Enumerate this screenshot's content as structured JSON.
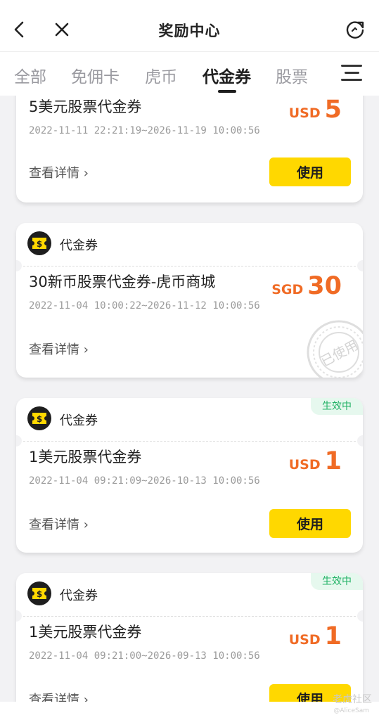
{
  "header": {
    "title": "奖励中心",
    "back_icon": "back-arrow-icon",
    "close_icon": "close-icon",
    "refresh_icon": "refresh-icon"
  },
  "tabs": [
    {
      "label": "全部",
      "active": false
    },
    {
      "label": "免佣卡",
      "active": false
    },
    {
      "label": "虎币",
      "active": false
    },
    {
      "label": "代金券",
      "active": true
    },
    {
      "label": "股票",
      "active": false
    }
  ],
  "colors": {
    "accent_yellow": "#ffd800",
    "amount_orange": "#f06b25",
    "status_green": "#22b266",
    "text_dark": "#222222",
    "text_gray": "#9a9a9a"
  },
  "coupons": [
    {
      "type": "",
      "name": "5美元股票代金券",
      "validity": "2022-11-11 22:21:19~2026-11-19 10:00:56",
      "currency": "USD",
      "amount": "5",
      "detail_label": "查看详情 ›",
      "button_label": "使用",
      "status": ""
    },
    {
      "type": "代金券",
      "name": "30新币股票代金券-虎币商城",
      "validity": "2022-11-04 10:00:22~2026-11-12 10:00:56",
      "currency": "SGD",
      "amount": "30",
      "detail_label": "查看详情 ›",
      "button_label": "",
      "status": "",
      "stamp": "已使用"
    },
    {
      "type": "代金券",
      "name": "1美元股票代金券",
      "validity": "2022-11-04 09:21:09~2026-10-13 10:00:56",
      "currency": "USD",
      "amount": "1",
      "detail_label": "查看详情 ›",
      "button_label": "使用",
      "status": "生效中"
    },
    {
      "type": "代金券",
      "name": "1美元股票代金券",
      "validity": "2022-11-04 09:21:00~2026-09-13 10:00:56",
      "currency": "USD",
      "amount": "1",
      "detail_label": "查看详情 ›",
      "button_label": "使用",
      "status": "生效中"
    }
  ],
  "watermark": {
    "brand": "老虎社区",
    "user": "@AliceSam"
  }
}
